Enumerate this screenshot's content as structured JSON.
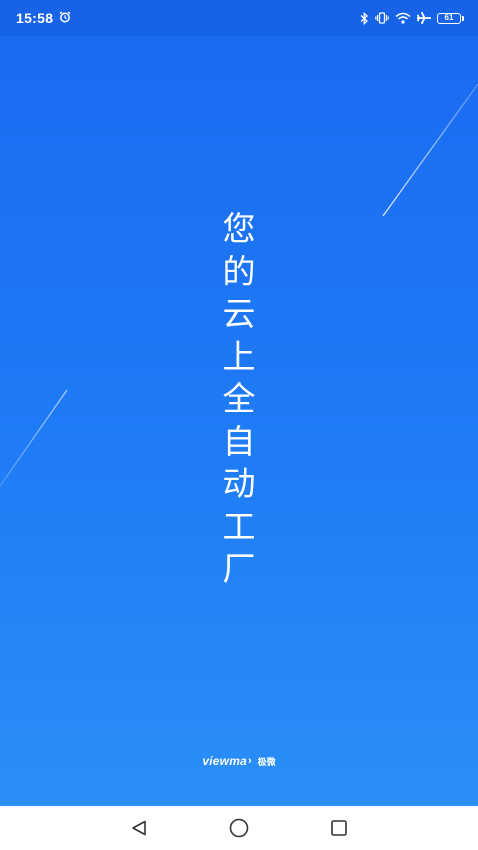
{
  "status_bar": {
    "time": "15:58",
    "battery_level": "61",
    "icons": [
      "alarm-icon",
      "bluetooth-icon",
      "vibrate-icon",
      "wifi-icon",
      "airplane-icon",
      "battery-icon"
    ]
  },
  "splash": {
    "slogan": "您的云上全自动工厂",
    "brand_name": "viewma",
    "brand_arrow": "›",
    "brand_cn": "极微"
  },
  "nav_bar": {
    "buttons": [
      "back-icon",
      "home-icon",
      "recents-icon"
    ]
  },
  "colors": {
    "status_bar_bg": "#1763e8",
    "gradient_top": "#1a6bf0",
    "gradient_bottom": "#2a8ff8",
    "text": "#ffffff",
    "nav_icon": "#333333"
  }
}
